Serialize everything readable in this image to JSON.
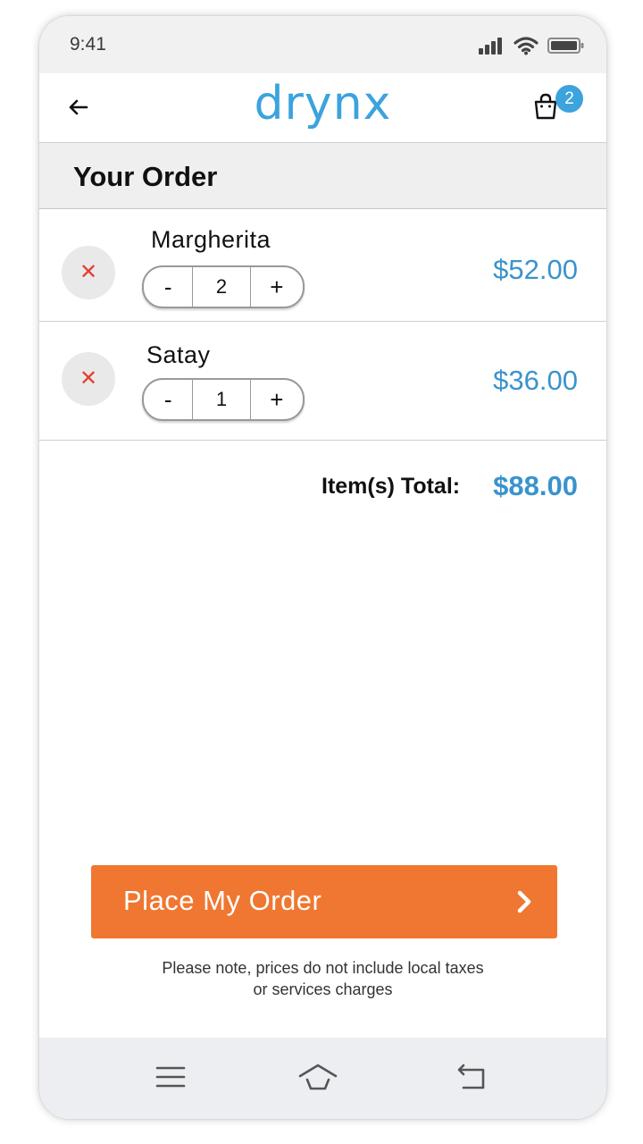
{
  "status_bar": {
    "time": "9:41",
    "icons": [
      "signal-icon",
      "wifi-icon",
      "battery-icon"
    ]
  },
  "header": {
    "logo": "drynx",
    "back_icon": "back-arrow-icon",
    "cart_icon": "shopping-bag-icon",
    "cart_count": "2"
  },
  "section": {
    "title": "Your Order"
  },
  "items": [
    {
      "name": "Margherita",
      "quantity": "2",
      "price": "$52.00",
      "minus_label": "-",
      "plus_label": "+",
      "remove_icon": "close-icon"
    },
    {
      "name": "Satay",
      "quantity": "1",
      "price": "$36.00",
      "minus_label": "-",
      "plus_label": "+",
      "remove_icon": "close-icon"
    }
  ],
  "total": {
    "label": "Item(s) Total:",
    "value": "$88.00"
  },
  "cta": {
    "label": "Place My Order",
    "icon": "chevron-right-icon"
  },
  "note": {
    "line1": "Please note, prices do not include local taxes",
    "line2": "or services charges"
  },
  "bottom_nav": {
    "items": [
      "menu-icon",
      "home-icon",
      "back-icon"
    ]
  },
  "colors": {
    "accent": "#3ca3dc",
    "price": "#3a93cc",
    "cta": "#f07731",
    "remove": "#e53e2c"
  }
}
